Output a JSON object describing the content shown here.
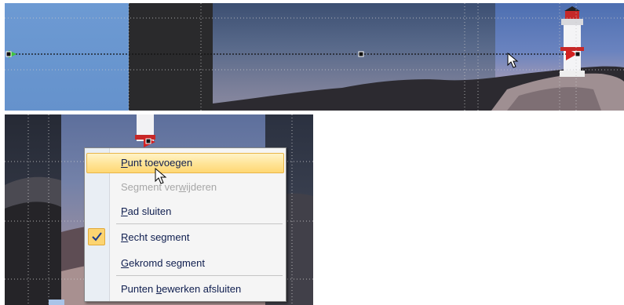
{
  "context_menu": {
    "items": [
      {
        "pre": "",
        "ul": "P",
        "post": "unt toevoegen",
        "state": "hover"
      },
      {
        "pre": "Segment ver",
        "ul": "w",
        "post": "ijderen",
        "state": "disabled"
      },
      {
        "pre": "",
        "ul": "P",
        "post": "ad sluiten",
        "state": "normal"
      },
      {
        "pre": "",
        "ul": "R",
        "post": "echt segment",
        "state": "checked"
      },
      {
        "pre": "",
        "ul": "G",
        "post": "ekromd segment",
        "state": "normal"
      },
      {
        "pre": "Punten ",
        "ul": "b",
        "post": "ewerken afsluiten",
        "state": "normal"
      }
    ]
  },
  "colors": {
    "menu_hover": "#ffd773",
    "check_bg": "#fcd471",
    "menu_text": "#0f1e4f",
    "disabled_text": "#a7a7a7",
    "start_point": "#3ec43e",
    "lighthouse_red": "#c62828"
  },
  "icons": {
    "cursor": "arrow-cursor-icon",
    "check": "checkmark-icon",
    "start_point": "start-point-handle-icon"
  }
}
